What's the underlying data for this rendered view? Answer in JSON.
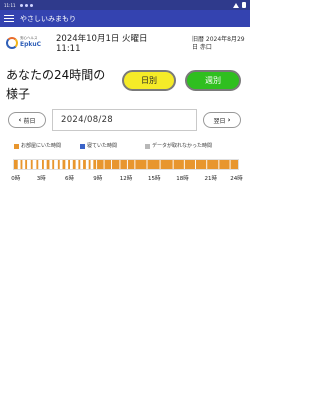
{
  "status_bar": {
    "time": "11:11"
  },
  "app_bar": {
    "title": "やさしいみまもり",
    "menu_icon": "hamburger-menu-icon"
  },
  "header": {
    "logo_small": "安心ヘルス",
    "logo_brand": "EpkuC",
    "current_date": "2024年10月1日 火曜日",
    "current_time": "11:11",
    "previous_label": "旧暦 2024年8月29日 赤口"
  },
  "main": {
    "heading": "あなたの24時間の様子",
    "daily_button": "日別",
    "weekly_button": "週別",
    "prev_label": "前日",
    "next_label": "翌日",
    "date_value": "2024/08/28"
  },
  "legend": [
    {
      "label": "お部屋にいた時間",
      "color": "#e8962e"
    },
    {
      "label": "寝ていた時間",
      "color": "#3a63c8"
    },
    {
      "label": "データが取れなかった時間",
      "color": "#b8b8b8"
    }
  ],
  "chart_data": {
    "type": "timeline",
    "x_range": [
      0,
      24
    ],
    "x_unit": "hours",
    "ticks": [
      "0時",
      "3時",
      "6時",
      "9時",
      "12時",
      "15時",
      "18時",
      "21時",
      "24時"
    ],
    "segments": [
      {
        "start": 0.0,
        "end": 0.4,
        "state": "room"
      },
      {
        "start": 0.7,
        "end": 0.9,
        "state": "room"
      },
      {
        "start": 1.2,
        "end": 1.4,
        "state": "room"
      },
      {
        "start": 1.8,
        "end": 2.0,
        "state": "room"
      },
      {
        "start": 2.4,
        "end": 2.6,
        "state": "room"
      },
      {
        "start": 3.0,
        "end": 3.2,
        "state": "room"
      },
      {
        "start": 3.5,
        "end": 3.8,
        "state": "room"
      },
      {
        "start": 4.1,
        "end": 4.3,
        "state": "room"
      },
      {
        "start": 4.7,
        "end": 4.9,
        "state": "room"
      },
      {
        "start": 5.2,
        "end": 5.5,
        "state": "room"
      },
      {
        "start": 5.8,
        "end": 6.0,
        "state": "room"
      },
      {
        "start": 6.3,
        "end": 6.6,
        "state": "room"
      },
      {
        "start": 6.9,
        "end": 7.1,
        "state": "room"
      },
      {
        "start": 7.4,
        "end": 7.7,
        "state": "room"
      },
      {
        "start": 8.0,
        "end": 8.2,
        "state": "room"
      },
      {
        "start": 8.5,
        "end": 8.8,
        "state": "room"
      },
      {
        "start": 8.9,
        "end": 9.6,
        "state": "room"
      },
      {
        "start": 9.7,
        "end": 10.4,
        "state": "room"
      },
      {
        "start": 10.5,
        "end": 11.3,
        "state": "room"
      },
      {
        "start": 11.4,
        "end": 12.1,
        "state": "room"
      },
      {
        "start": 12.2,
        "end": 12.9,
        "state": "room"
      },
      {
        "start": 13.0,
        "end": 14.2,
        "state": "room"
      },
      {
        "start": 14.3,
        "end": 15.6,
        "state": "room"
      },
      {
        "start": 15.7,
        "end": 17.0,
        "state": "room"
      },
      {
        "start": 17.1,
        "end": 18.2,
        "state": "room"
      },
      {
        "start": 18.3,
        "end": 19.4,
        "state": "room"
      },
      {
        "start": 19.5,
        "end": 20.6,
        "state": "room"
      },
      {
        "start": 20.7,
        "end": 21.9,
        "state": "room"
      },
      {
        "start": 22.0,
        "end": 23.1,
        "state": "room"
      },
      {
        "start": 23.2,
        "end": 24.0,
        "state": "room"
      }
    ]
  }
}
